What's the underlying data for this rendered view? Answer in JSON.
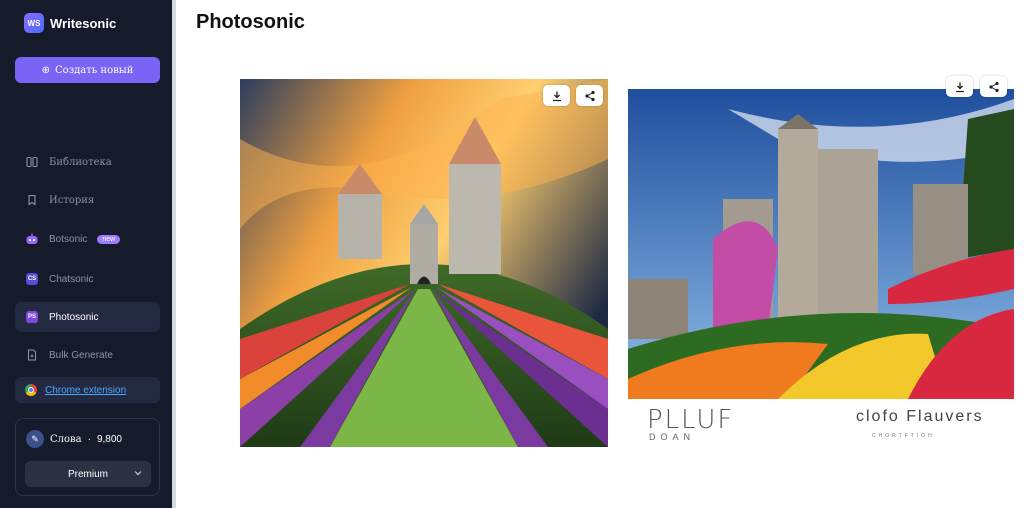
{
  "app": {
    "name": "Writesonic",
    "logo_mark": "WS"
  },
  "sidebar": {
    "new_button": {
      "label": "Создать новый",
      "icon": "plus-circle-icon"
    },
    "items": [
      {
        "label": "Библиотека",
        "icon": "library-icon"
      },
      {
        "label": "История",
        "icon": "bookmark-icon"
      },
      {
        "label": "Botsonic",
        "icon": "bot-icon",
        "badge": "new"
      },
      {
        "label": "Chatsonic",
        "icon": "cs-icon",
        "icon_text": "CS"
      },
      {
        "label": "Photosonic",
        "icon": "ps-icon",
        "icon_text": "PS",
        "active": true
      },
      {
        "label": "Bulk Generate",
        "icon": "document-icon"
      }
    ],
    "chrome_extension": {
      "label": "Chrome extension",
      "icon": "chrome-icon"
    },
    "words": {
      "label": "Слова",
      "separator": "·",
      "count": "9,800"
    },
    "plan": {
      "selected": "Premium"
    }
  },
  "main": {
    "title": "Photosonic",
    "images": [
      {
        "name": "castle-flowers-image-1",
        "actions": [
          "download-icon",
          "share-icon"
        ]
      },
      {
        "name": "castle-flowers-image-2",
        "actions": [
          "download-icon",
          "share-icon"
        ],
        "caption_left": "PLLUF",
        "caption_left_sub": "DOAN",
        "caption_right": "clofo Flauvers",
        "caption_right_sub": "CHORTFTIOH"
      }
    ]
  },
  "colors": {
    "sidebar_bg": "#161b2c",
    "accent": "#7a63f5",
    "link": "#4aa8ff"
  }
}
